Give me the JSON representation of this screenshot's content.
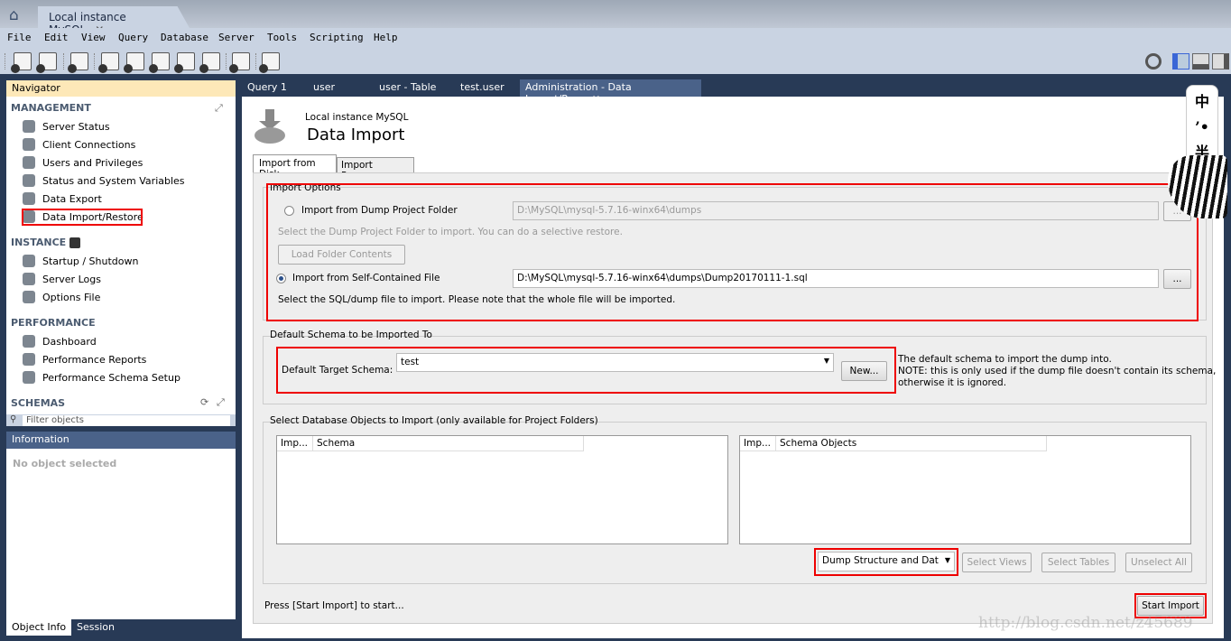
{
  "window": {
    "tab_title": "Local instance MySQL",
    "close": "✕"
  },
  "menu": [
    "File",
    "Edit",
    "View",
    "Query",
    "Database",
    "Server",
    "Tools",
    "Scripting",
    "Help"
  ],
  "navigator": {
    "title": "Navigator",
    "management": {
      "title": "MANAGEMENT",
      "items": [
        "Server Status",
        "Client Connections",
        "Users and Privileges",
        "Status and System Variables",
        "Data Export",
        "Data Import/Restore"
      ]
    },
    "instance": {
      "title": "INSTANCE",
      "items": [
        "Startup / Shutdown",
        "Server Logs",
        "Options File"
      ]
    },
    "performance": {
      "title": "PERFORMANCE",
      "items": [
        "Dashboard",
        "Performance Reports",
        "Performance Schema Setup"
      ]
    },
    "schemas": {
      "title": "SCHEMAS",
      "filter_placeholder": "Filter objects"
    }
  },
  "information": {
    "title": "Information",
    "message": "No object selected",
    "tabs": [
      "Object Info",
      "Session"
    ]
  },
  "editor_tabs": [
    "Query 1",
    "user",
    "user - Table",
    "test.user",
    "Administration - Data Import/Res..."
  ],
  "page": {
    "subtitle": "Local instance MySQL",
    "title": "Data Import",
    "tabs": [
      "Import from Disk",
      "Import Progress"
    ],
    "import_options": {
      "title": "Import Options",
      "dump_folder_label": "Import from Dump Project Folder",
      "dump_folder_path": "D:\\MySQL\\mysql-5.7.16-winx64\\dumps",
      "browse": "...",
      "folder_hint": "Select the Dump Project Folder to import. You can do a selective restore.",
      "load_folder": "Load Folder Contents",
      "self_contained_label": "Import from Self-Contained File",
      "self_contained_path": "D:\\MySQL\\mysql-5.7.16-winx64\\dumps\\Dump20170111-1.sql",
      "file_hint": "Select the SQL/dump file to import. Please note that the whole file will be imported.",
      "selected": "self_contained"
    },
    "schema": {
      "title": "Default Schema to be Imported To",
      "label": "Default Target Schema:",
      "value": "test",
      "new_button": "New...",
      "note1": "The default schema to import the dump into.",
      "note2": "NOTE: this is only used if the dump file doesn't contain its schema,",
      "note3": "otherwise it is ignored."
    },
    "objects": {
      "title": "Select Database Objects to Import (only available for Project Folders)",
      "left_cols": [
        "Imp...",
        "Schema"
      ],
      "right_cols": [
        "Imp...",
        "Schema Objects"
      ],
      "dump_type": "Dump Structure and Dat",
      "select_views": "Select Views",
      "select_tables": "Select Tables",
      "unselect_all": "Unselect All"
    },
    "status": "Press [Start Import] to start...",
    "start_import": "Start Import"
  },
  "watermark": "http://blog.csdn.net/z45689",
  "overlay_chars": [
    "中",
    "’•",
    "半"
  ],
  "colors": {
    "highlight": "#ee0000",
    "navigator_header": "#fde8b8",
    "info_header": "#4a6289",
    "frame": "#283a56"
  }
}
